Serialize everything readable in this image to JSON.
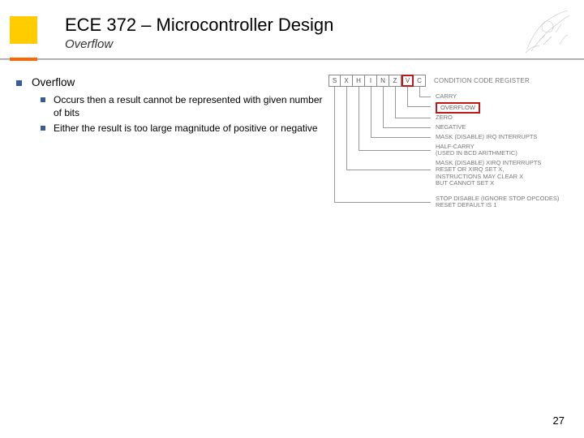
{
  "header": {
    "title": "ECE 372 – Microcontroller Design",
    "subtitle": "Overflow"
  },
  "content": {
    "heading": "Overflow",
    "bullets": [
      "Occurs then a result cannot be represented with given number of bits",
      "Either the result is too large magnitude of positive or negative"
    ]
  },
  "diagram": {
    "register_bits": [
      "S",
      "X",
      "H",
      "I",
      "N",
      "Z",
      "V",
      "C"
    ],
    "highlight_bit": "V",
    "register_label": "CONDITION CODE REGISTER",
    "flags": [
      {
        "name": "CARRY",
        "highlight": false
      },
      {
        "name": "OVERFLOW",
        "highlight": true
      },
      {
        "name": "ZERO",
        "highlight": false
      },
      {
        "name": "NEGATIVE",
        "highlight": false
      },
      {
        "name": "MASK (DISABLE) IRQ INTERRUPTS",
        "highlight": false
      },
      {
        "name": "HALF-CARRY\n(USED IN BCD ARITHMETIC)",
        "highlight": false
      },
      {
        "name": "MASK (DISABLE) XIRQ INTERRUPTS\nRESET OR XIRQ SET X,\nINSTRUCTIONS MAY CLEAR X\nBUT CANNOT SET X",
        "highlight": false
      },
      {
        "name": "STOP DISABLE (IGNORE STOP OPCODES)\nRESET DEFAULT IS 1",
        "highlight": false
      }
    ]
  },
  "page_number": "27"
}
